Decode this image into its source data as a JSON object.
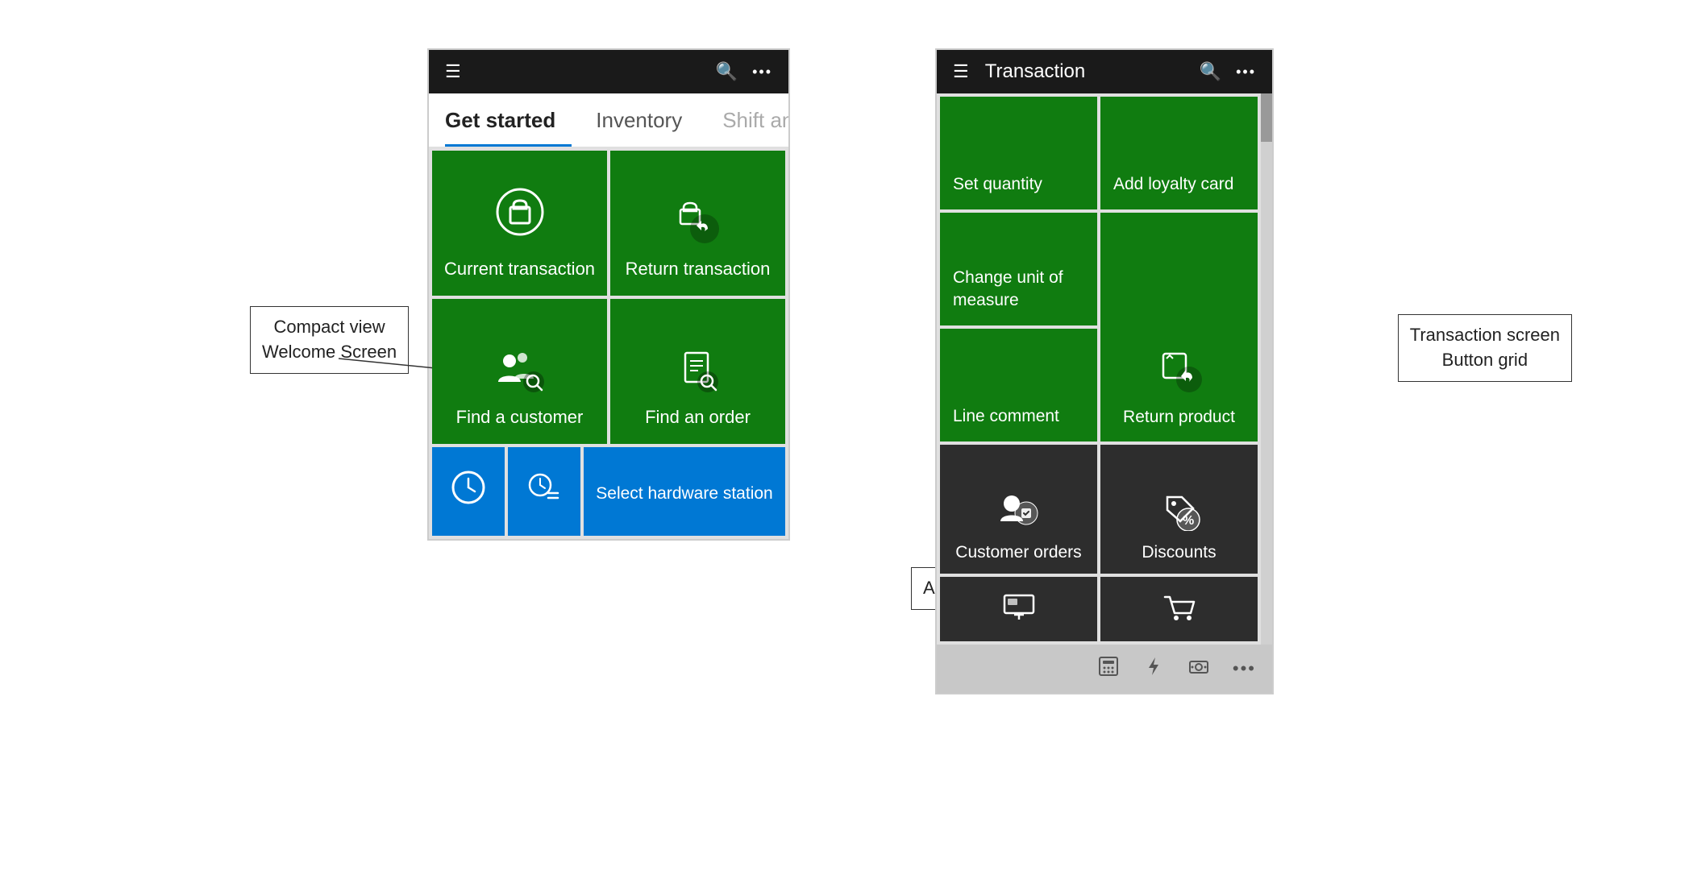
{
  "left_panel": {
    "header": {
      "hamburger": "☰",
      "search": "🔍",
      "more": "···"
    },
    "tabs": [
      {
        "label": "Get started",
        "active": true
      },
      {
        "label": "Inventory",
        "active": false
      },
      {
        "label": "Shift and",
        "active": false,
        "faded": true
      }
    ],
    "tiles": [
      {
        "label": "Current transaction",
        "type": "green",
        "icon": "bag"
      },
      {
        "label": "Return transaction",
        "type": "green",
        "icon": "bag-return"
      },
      {
        "label": "Find a customer",
        "type": "green",
        "icon": "find-customer"
      },
      {
        "label": "Find an order",
        "type": "green",
        "icon": "find-order"
      }
    ],
    "bottom_row": [
      {
        "label": "",
        "type": "blue",
        "icon": "clock"
      },
      {
        "label": "",
        "type": "blue",
        "icon": "clock-list"
      },
      {
        "label": "Select hardware station",
        "type": "blue",
        "icon": ""
      }
    ]
  },
  "left_annotation": {
    "text": "Compact view\nWelcome Screen"
  },
  "right_panel": {
    "header": {
      "hamburger": "☰",
      "title": "Transaction",
      "search": "🔍",
      "more": "···"
    },
    "tiles": [
      {
        "label": "Set quantity",
        "type": "green",
        "icon": ""
      },
      {
        "label": "Add loyalty card",
        "type": "green",
        "icon": ""
      },
      {
        "label": "Change unit of\nmeasure",
        "type": "green",
        "icon": ""
      },
      {
        "label": "Return product",
        "type": "green",
        "icon": "return-product",
        "tall": true
      },
      {
        "label": "Line comment",
        "type": "green",
        "icon": ""
      },
      {
        "label": "Customer orders",
        "type": "dark",
        "icon": "customer-orders"
      },
      {
        "label": "Discounts",
        "type": "dark",
        "icon": "discounts"
      }
    ],
    "partial_tiles": [
      {
        "label": "",
        "type": "dark",
        "icon": "display"
      },
      {
        "label": "",
        "type": "dark",
        "icon": "cart"
      }
    ],
    "action_bar": {
      "icons": [
        "calculator",
        "lightning",
        "money",
        "more"
      ]
    }
  },
  "right_annotation_top": {
    "text": "Transaction screen\nButton grid"
  },
  "right_annotation_bottom": {
    "text": "Actions menu"
  }
}
